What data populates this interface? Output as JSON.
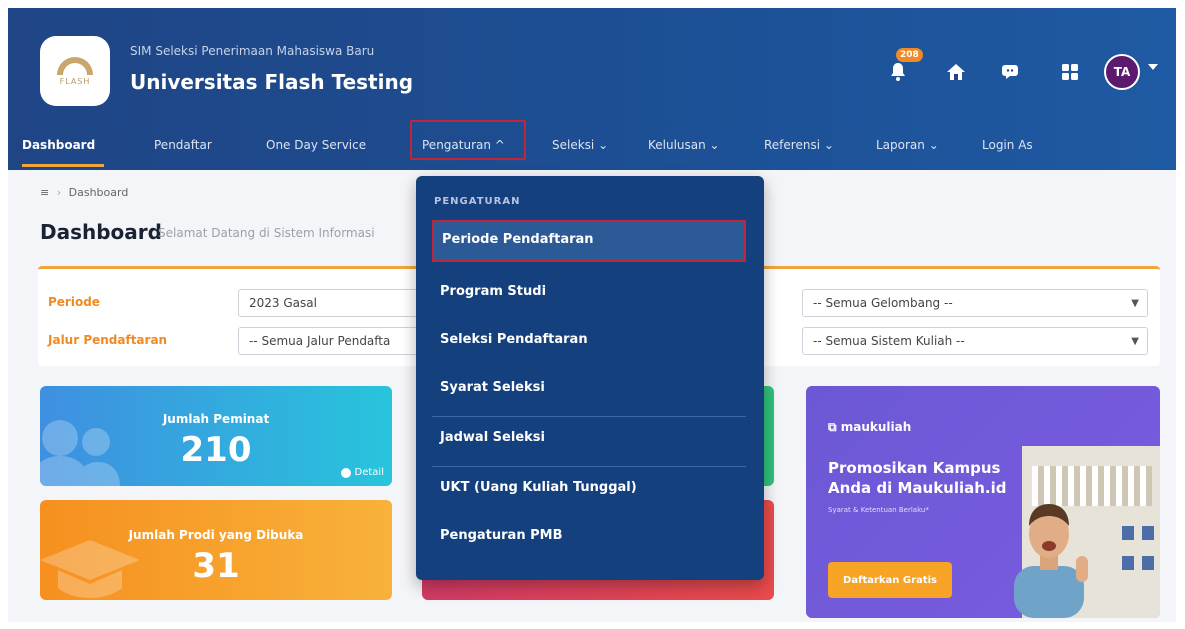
{
  "header": {
    "subtitle": "SIM Seleksi Penerimaan Mahasiswa Baru",
    "title": "Universitas Flash Testing",
    "logo_text": "FLASH",
    "notification_count": "208",
    "avatar_initials": "TA"
  },
  "nav": {
    "items": [
      {
        "label": "Dashboard"
      },
      {
        "label": "Pendaftar"
      },
      {
        "label": "One Day Service"
      },
      {
        "label": "Pengaturan ^"
      },
      {
        "label": "Seleksi ⌄"
      },
      {
        "label": "Kelulusan ⌄"
      },
      {
        "label": "Referensi ⌄"
      },
      {
        "label": "Laporan ⌄"
      },
      {
        "label": "Login As"
      }
    ]
  },
  "breadcrumb": {
    "icon": "≡",
    "sep": "›",
    "label": "Dashboard"
  },
  "page": {
    "title": "Dashboard",
    "subtitle": "Selamat Datang di Sistem Informasi"
  },
  "filters": {
    "periode_label": "Periode",
    "periode_value": "2023 Gasal",
    "jalur_label": "Jalur Pendaftaran",
    "jalur_value": "-- Semua Jalur Pendafta",
    "gelombang_value": "-- Semua Gelombang --",
    "sistem_value": "-- Semua Sistem Kuliah --"
  },
  "stats": {
    "peminat_label": "Jumlah Peminat",
    "peminat_value": "210",
    "detail_label": "Detail",
    "prodi_label": "Jumlah Prodi yang Dibuka",
    "prodi_value": "31"
  },
  "promo": {
    "brand": "maukuliah",
    "headline": "Promosikan Kampus Anda di Maukuliah.id",
    "note": "Syarat & Ketentuan Berlaku*",
    "cta": "Daftarkan Gratis"
  },
  "dropdown": {
    "header": "PENGATURAN",
    "items": [
      {
        "label": "Periode Pendaftaran"
      },
      {
        "label": "Program Studi"
      },
      {
        "label": "Seleksi Pendaftaran"
      },
      {
        "label": "Syarat Seleksi"
      },
      {
        "label": "Jadwal Seleksi"
      },
      {
        "label": "UKT (Uang Kuliah Tunggal)"
      },
      {
        "label": "Pengaturan PMB"
      }
    ]
  },
  "icons": {
    "bell": "bell-icon",
    "home": "home-icon",
    "chat": "chat-icon",
    "apps": "grid-icon"
  },
  "colors": {
    "header_bg": "#1f4585",
    "accent": "#f0a63a",
    "highlight_border": "#c0263a",
    "dropdown_bg": "#14407d"
  }
}
